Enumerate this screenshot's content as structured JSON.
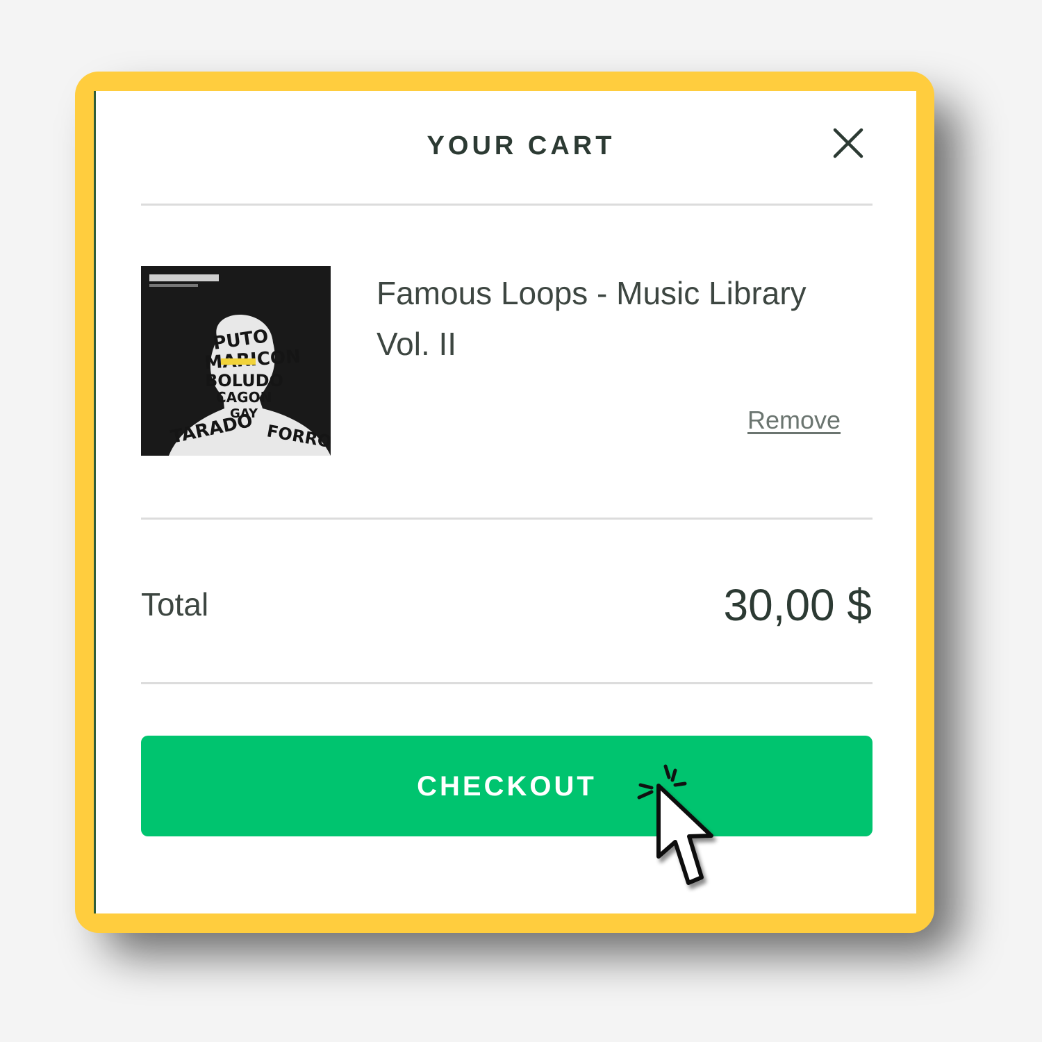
{
  "cart": {
    "title": "YOUR CART",
    "close_icon": "close-icon",
    "item": {
      "name": "Famous Loops - Music Library Vol. II",
      "remove_label": "Remove",
      "image_icon": "album-cover"
    },
    "total_label": "Total",
    "total_value": "30,00 $",
    "checkout_label": "CHECKOUT"
  },
  "colors": {
    "frame": "#ffcd3e",
    "accent": "#00c46f",
    "text": "#3d4641",
    "divider": "#dcdcdc"
  },
  "cursor_icon": "hand-pointer-click-icon"
}
